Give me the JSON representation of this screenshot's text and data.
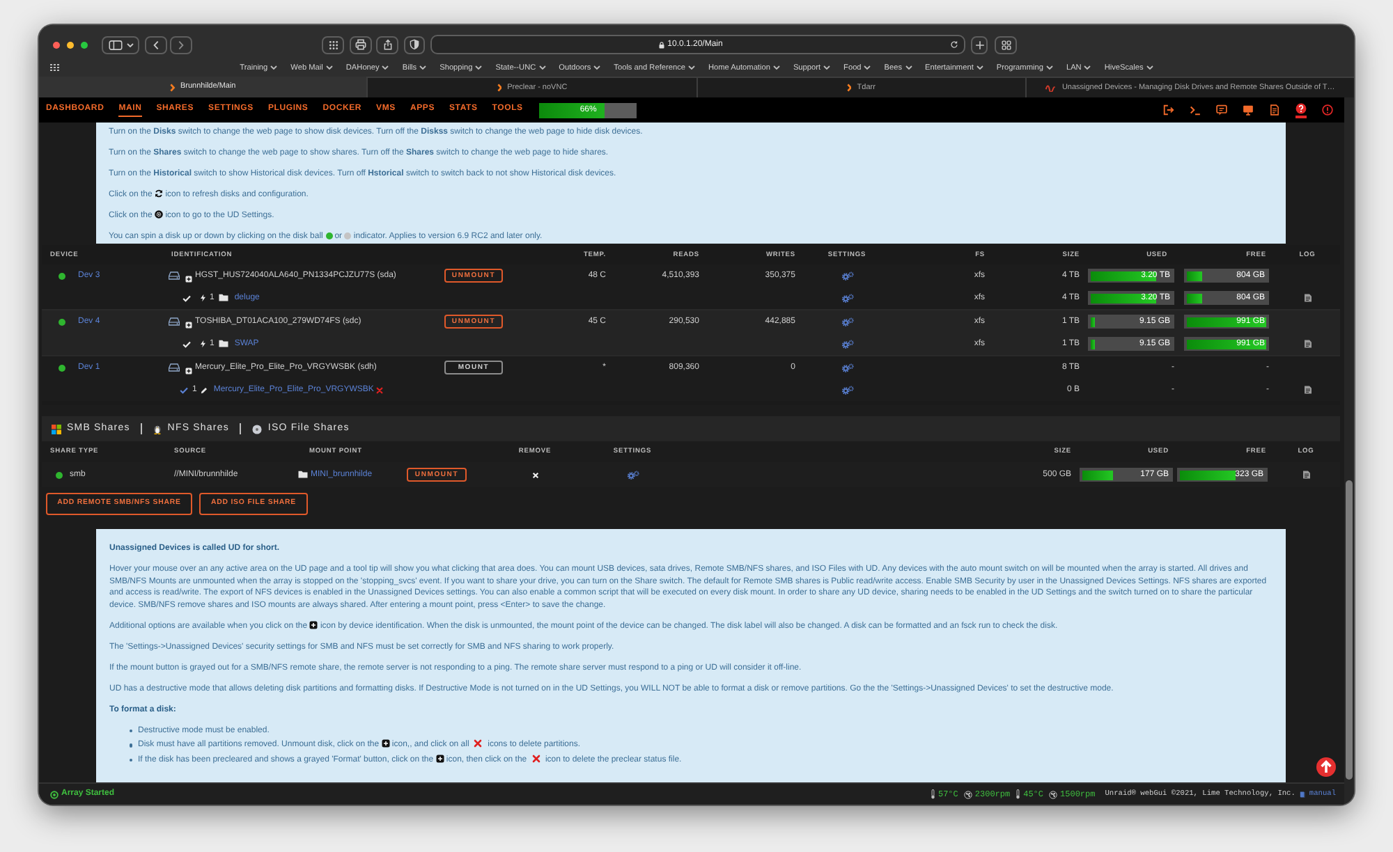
{
  "browser": {
    "address": "10.0.1.20/Main",
    "bookmarks": [
      "Training",
      "Web Mail",
      "DAHoney",
      "Bills",
      "Shopping",
      "State--UNC",
      "Outdoors",
      "Tools and Reference",
      "Home Automation",
      "Support",
      "Food",
      "Bees",
      "Entertainment",
      "Programming",
      "LAN",
      "HiveScales"
    ],
    "tabs": [
      {
        "title": "Brunnhilde/Main",
        "kind": "chevron",
        "selected": true
      },
      {
        "title": "Preclear - noVNC",
        "kind": "chevron",
        "selected": false
      },
      {
        "title": "Tdarr",
        "kind": "chevron",
        "selected": false
      },
      {
        "title": "Unassigned Devices - Managing Disk Drives and Remote Shares Outside of T…",
        "kind": "wave",
        "selected": false
      }
    ]
  },
  "nav": {
    "items": [
      {
        "label": "DASHBOARD",
        "selected": false
      },
      {
        "label": "MAIN",
        "selected": true
      },
      {
        "label": "SHARES",
        "selected": false
      },
      {
        "label": "SETTINGS",
        "selected": false
      },
      {
        "label": "PLUGINS",
        "selected": false
      },
      {
        "label": "DOCKER",
        "selected": false
      },
      {
        "label": "VMS",
        "selected": false
      },
      {
        "label": "APPS",
        "selected": false
      },
      {
        "label": "STATS",
        "selected": false
      },
      {
        "label": "TOOLS",
        "selected": false
      }
    ],
    "load": {
      "reading": "66%",
      "level": 0.66
    },
    "help_on": true
  },
  "help_top": {
    "paragraphs": [
      {
        "kind": "text",
        "segments": [
          {
            "kind": "text",
            "text": "Turn on the **Disks** switch to change the web page to show disk devices. Turn off the **Diskss** switch to change the web page to hide disk devices."
          }
        ]
      },
      {
        "kind": "text",
        "segments": [
          {
            "kind": "text",
            "text": "Turn on the **Shares** switch to change the web page to show shares. Turn off the **Shares** switch to change the web page to hide shares."
          }
        ]
      },
      {
        "kind": "text",
        "segments": [
          {
            "kind": "text",
            "text": "Turn on the **Historical** switch to show Historical disk devices. Turn off **Hstorical** switch to switch back to not show Historical disk devices."
          }
        ]
      },
      {
        "kind": "text",
        "segments": [
          {
            "kind": "text",
            "text": "Click on the"
          },
          {
            "kind": "refresh"
          },
          {
            "kind": "text",
            "text": "icon to refresh disks and configuration."
          }
        ]
      },
      {
        "kind": "text",
        "segments": [
          {
            "kind": "text",
            "text": "Click on the"
          },
          {
            "kind": "settings"
          },
          {
            "kind": "text",
            "text": "icon to go to the UD Settings."
          }
        ]
      },
      {
        "kind": "text",
        "segments": [
          {
            "kind": "text",
            "text": "You can spin a disk up or down by clicking on the disk ball"
          },
          {
            "kind": "ball",
            "color": "#2fb52f"
          },
          {
            "kind": "text",
            "text": "or"
          },
          {
            "kind": "ball",
            "color": "#c4c4c4"
          },
          {
            "kind": "text",
            "text": "indicator. Applies to version 6.9 RC2 and later only."
          }
        ]
      }
    ]
  },
  "disk_table": {
    "columns": [
      "DEVICE",
      "IDENTIFICATION",
      "TEMP.",
      "READS",
      "WRITES",
      "SETTINGS",
      "FS",
      "SIZE",
      "USED",
      "FREE",
      "LOG"
    ],
    "disks": [
      {
        "device": "Dev 3",
        "spun_up": true,
        "identification": "HGST_HUS724040ALA640_PN1334PCJZU77S (sda)",
        "action": {
          "label": "UNMOUNT",
          "kind": "unmount"
        },
        "temp": "48 C",
        "reads": "4,510,393",
        "writes": "350,375",
        "fs": "xfs",
        "size": "4 TB",
        "used": {
          "reading": "3.20 TB",
          "level": 0.8
        },
        "free": {
          "reading": "804 GB",
          "level": 0.2
        },
        "partitions": [
          {
            "kind": "mounted",
            "number": "1",
            "label": "deluge",
            "fs": "xfs",
            "size": "4 TB",
            "used": {
              "reading": "3.20 TB",
              "level": 0.8
            },
            "free": {
              "reading": "804 GB",
              "level": 0.2
            }
          }
        ]
      },
      {
        "device": "Dev 4",
        "spun_up": true,
        "identification": "TOSHIBA_DT01ACA100_279WD74FS (sdc)",
        "action": {
          "label": "UNMOUNT",
          "kind": "unmount"
        },
        "temp": "45 C",
        "reads": "290,530",
        "writes": "442,885",
        "fs": "xfs",
        "size": "1 TB",
        "used": {
          "reading": "9.15 GB",
          "level": 0.01
        },
        "free": {
          "reading": "991 GB",
          "level": 0.99
        },
        "partitions": [
          {
            "kind": "mounted",
            "number": "1",
            "label": "SWAP",
            "fs": "xfs",
            "size": "1 TB",
            "used": {
              "reading": "9.15 GB",
              "level": 0.01
            },
            "free": {
              "reading": "991 GB",
              "level": 0.99
            }
          }
        ]
      },
      {
        "device": "Dev 1",
        "spun_up": true,
        "identification": "Mercury_Elite_Pro_Elite_Pro_VRGYWSBK (sdh)",
        "action": {
          "label": "MOUNT",
          "kind": "mount"
        },
        "temp": "*",
        "reads": "809,360",
        "writes": "0",
        "size": "8 TB",
        "used": {
          "reading": "-"
        },
        "free": {
          "reading": "-"
        },
        "partitions": [
          {
            "kind": "unmounted",
            "number": "1",
            "label": "Mercury_Elite_Pro_Elite_Pro_VRGYWSBK",
            "size": "0 B",
            "used": {
              "reading": "-"
            },
            "free": {
              "reading": "-"
            }
          }
        ]
      }
    ]
  },
  "shares": {
    "sections": [
      {
        "label": "SMB Shares",
        "kind": "smb"
      },
      {
        "label": "NFS Shares",
        "kind": "nfs"
      },
      {
        "label": "ISO File Shares",
        "kind": "iso"
      }
    ],
    "columns": [
      "SHARE TYPE",
      "SOURCE",
      "MOUNT POINT",
      "REMOVE",
      "SETTINGS",
      "SIZE",
      "USED",
      "FREE",
      "LOG"
    ],
    "rows": [
      {
        "online": true,
        "type": "smb",
        "source": "//MINI/brunnhilde",
        "mount_point": "MINI_brunnhilde",
        "action": {
          "label": "UNMOUNT",
          "kind": "unmount"
        },
        "size": "500 GB",
        "used": {
          "reading": "177 GB",
          "level": 0.35
        },
        "free": {
          "reading": "323 GB",
          "level": 0.65
        }
      }
    ],
    "buttons": [
      "ADD REMOTE SMB/NFS SHARE",
      "ADD ISO FILE SHARE"
    ]
  },
  "help_bottom": {
    "paragraphs": [
      {
        "kind": "heading",
        "segments": [
          {
            "kind": "text",
            "text": "Unassigned Devices is called UD for short."
          }
        ]
      },
      {
        "kind": "text",
        "segments": [
          {
            "kind": "text",
            "text": "Hover your mouse over an any active area on the UD page and a tool tip will show you what clicking that area does. You can mount USB devices, sata drives, Remote SMB/NFS shares, and ISO Files with UD. Any devices with the auto mount switch on will be mounted when the array is started. All drives and SMB/NFS Mounts are unmounted when the array is stopped on the 'stopping_svcs' event. If you want to share your drive, you can turn on the Share switch. The default for Remote SMB shares is Public read/write access. Enable SMB Security by user in the Unassigned Devices Settings. NFS shares are exported and access is read/write. The export of NFS devices is enabled in the Unassigned Devices settings. You can also enable a common script that will be executed on every disk mount. In order to share any UD device, sharing needs to be enabled in the UD Settings and the switch turned on to share the particular device. SMB/NFS remove shares and ISO mounts are always shared. After entering a mount point, press <Enter> to save the change."
          }
        ]
      },
      {
        "kind": "text",
        "segments": [
          {
            "kind": "text",
            "text": "Additional options are available when you click on the"
          },
          {
            "kind": "toggle"
          },
          {
            "kind": "text",
            "text": "icon by device identification. When the disk is unmounted, the mount point of the device can be changed. The disk label will also be changed. A disk can be formatted and an fsck run to check the disk."
          }
        ]
      },
      {
        "kind": "text",
        "segments": [
          {
            "kind": "text",
            "text": "The 'Settings->Unassigned Devices' security settings for SMB and NFS must be set correctly for SMB and NFS sharing to work properly."
          }
        ]
      },
      {
        "kind": "text",
        "segments": [
          {
            "kind": "text",
            "text": "If the mount button is grayed out for a SMB/NFS remote share, the remote server is not responding to a ping. The remote share server must respond to a ping or UD will consider it off-line."
          }
        ]
      },
      {
        "kind": "text",
        "segments": [
          {
            "kind": "text",
            "text": "UD has a destructive mode that allows deleting disk partitions and formatting disks. If Destructive Mode is not turned on in the UD Settings, you WILL NOT be able to format a disk or remove partitions. Go the the 'Settings->Unassigned Devices' to set the destructive mode."
          }
        ]
      },
      {
        "kind": "heading",
        "segments": [
          {
            "kind": "text",
            "text": "To format a disk:"
          }
        ]
      },
      {
        "kind": "bullet",
        "segments": [
          {
            "kind": "text",
            "text": "Destructive mode must be enabled."
          }
        ]
      },
      {
        "kind": "bullet",
        "segments": [
          {
            "kind": "text",
            "text": "Disk must have all partitions removed. Unmount disk, click on the"
          },
          {
            "kind": "toggle"
          },
          {
            "kind": "text",
            "text": "icon,, and click on all"
          },
          {
            "kind": "cross"
          },
          {
            "kind": "text",
            "text": "icons to delete partitions."
          }
        ]
      },
      {
        "kind": "bullet",
        "segments": [
          {
            "kind": "text",
            "text": "If the disk has been precleared and shows a grayed 'Format' button, click on the"
          },
          {
            "kind": "toggle"
          },
          {
            "kind": "text",
            "text": "icon, then click on the"
          },
          {
            "kind": "cross"
          },
          {
            "kind": "text",
            "text": "icon to delete the preclear status file."
          }
        ]
      }
    ]
  },
  "status_bar": {
    "array": "Array Started",
    "sensors": [
      {
        "kind": "temp",
        "reading": "57°C"
      },
      {
        "kind": "fan",
        "reading": "2300rpm"
      },
      {
        "kind": "temp",
        "reading": "45°C"
      },
      {
        "kind": "fan",
        "reading": "1500rpm"
      }
    ],
    "copyright": "Unraid® webGui ©2021, Lime Technology, Inc.",
    "manual": "manual"
  }
}
